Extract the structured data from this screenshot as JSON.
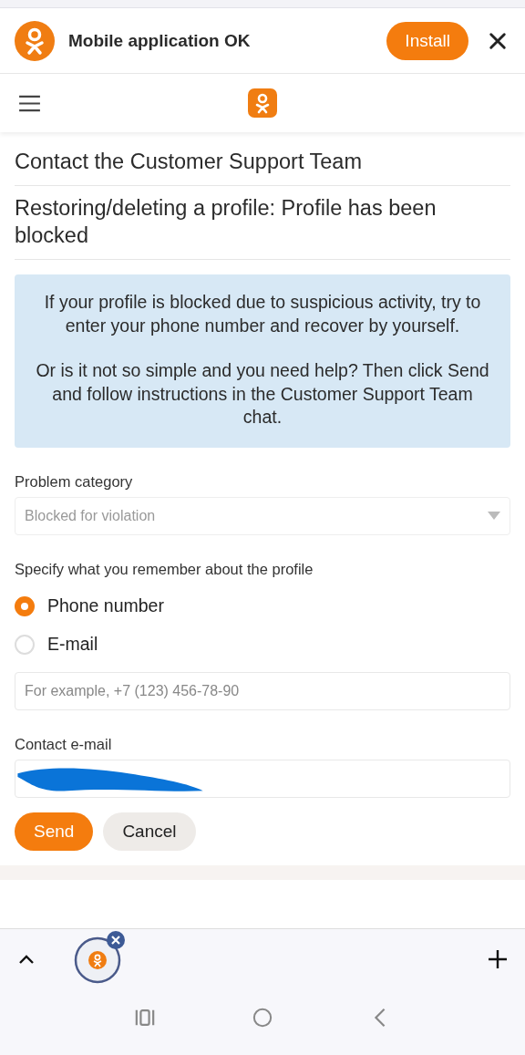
{
  "app_banner": {
    "title": "Mobile application OK",
    "install_button": "Install"
  },
  "breadcrumbs": [
    "Contact the Customer Support Team",
    "Restoring/deleting a profile: Profile has been blocked"
  ],
  "info_box": {
    "paragraphs": [
      "If your profile is blocked due to suspicious activity, try to enter your phone number and recover by yourself.",
      "Or is it not so simple and you need help? Then click Send and follow instructions in the Customer Support Team chat."
    ]
  },
  "problem_category": {
    "label": "Problem category",
    "value": "Blocked for violation"
  },
  "remember": {
    "label": "Specify what you remember about the profile",
    "options": [
      {
        "label": "Phone number",
        "selected": true
      },
      {
        "label": "E-mail",
        "selected": false
      }
    ],
    "placeholder": "For example, +7 (123) 456-78-90"
  },
  "contact_email": {
    "label": "Contact e-mail"
  },
  "buttons": [
    {
      "label": "Send",
      "kind": "primary"
    },
    {
      "label": "Cancel",
      "kind": "secondary"
    }
  ]
}
